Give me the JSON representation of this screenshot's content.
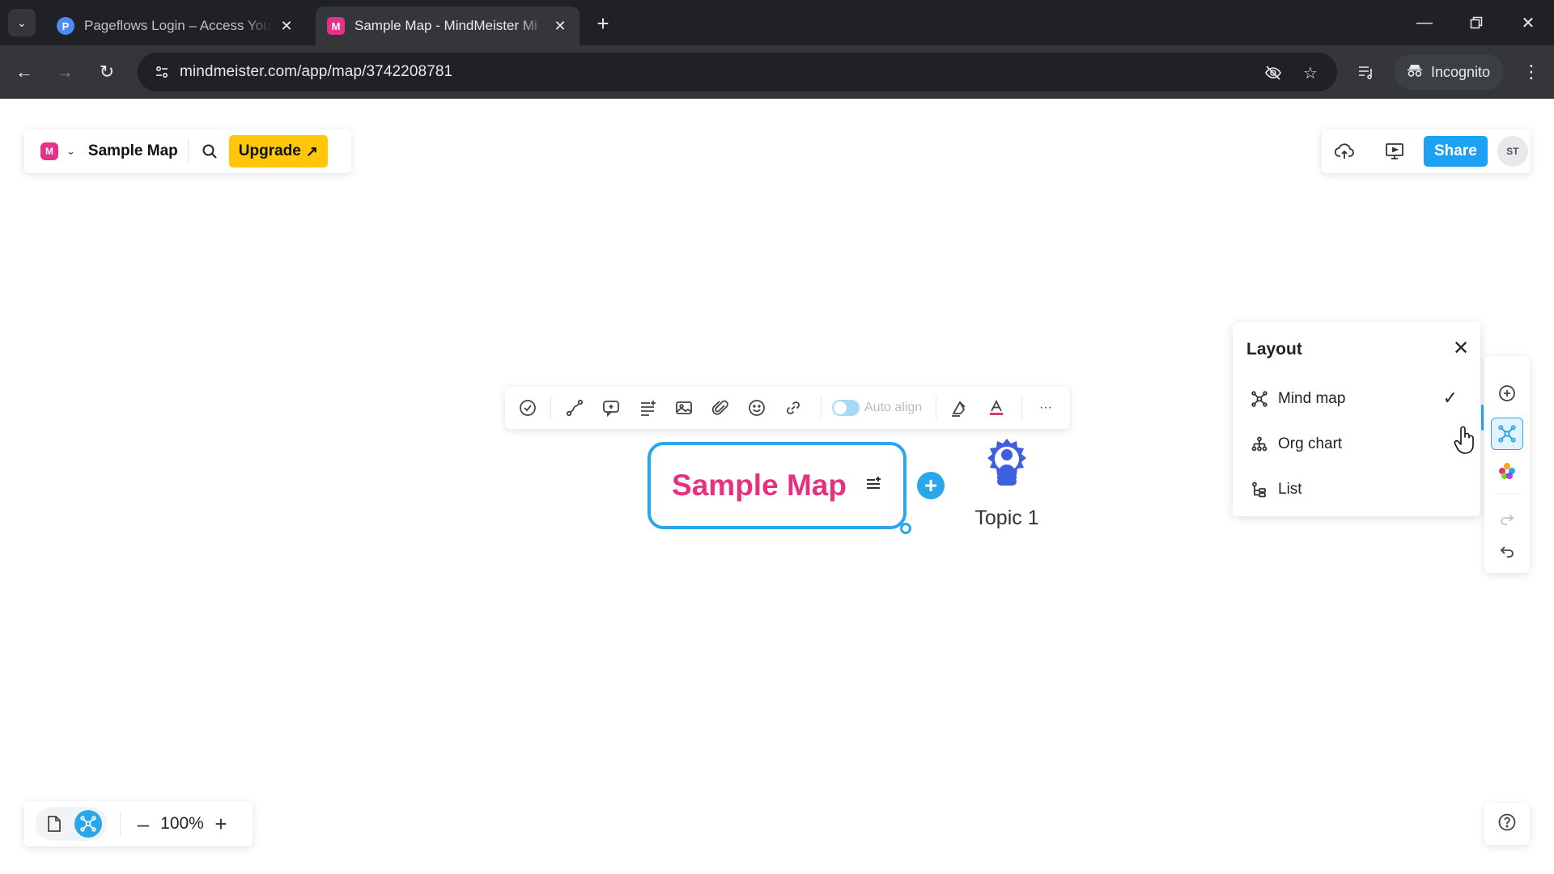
{
  "browser": {
    "tabs": [
      {
        "title": "Pageflows Login – Access Your",
        "favicon": "P",
        "active": false
      },
      {
        "title": "Sample Map - MindMeister Mi",
        "favicon": "M",
        "active": true
      }
    ],
    "new_tab": "+",
    "url": "mindmeister.com/app/map/3742208781",
    "incognito_label": "Incognito"
  },
  "app": {
    "logo": "M",
    "map_title": "Sample Map",
    "upgrade_label": "Upgrade",
    "upgrade_arrow": "↗",
    "share_label": "Share",
    "avatar_initials": "ST",
    "accent_color": "#2aa7e9",
    "brand_color": "#e4318a"
  },
  "node_toolbar": {
    "auto_align_label": "Auto align",
    "auto_align_on": true,
    "more": "···"
  },
  "map": {
    "root_label": "Sample Map",
    "child_label": "Topic 1",
    "add_symbol": "+"
  },
  "layout_panel": {
    "title": "Layout",
    "close": "✕",
    "items": [
      {
        "label": "Mind map",
        "icon": "mindmap-icon",
        "checked": true
      },
      {
        "label": "Org chart",
        "icon": "org-chart-icon",
        "checked": false
      },
      {
        "label": "List",
        "icon": "list-icon",
        "checked": false
      }
    ],
    "checkmark": "✓"
  },
  "zoom": {
    "level": "100%",
    "minus": "–",
    "plus": "+"
  }
}
